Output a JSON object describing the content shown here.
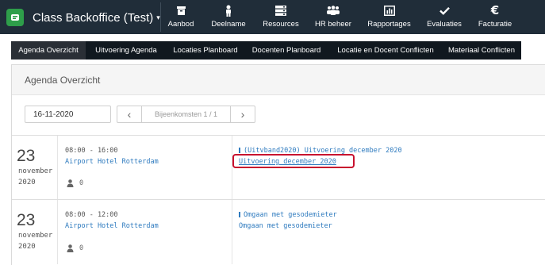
{
  "app": {
    "title": "Class Backoffice (Test)",
    "caret": "▾"
  },
  "topnav": [
    {
      "label": "Aanbod",
      "icon": "box-icon"
    },
    {
      "label": "Deelname",
      "icon": "person-icon"
    },
    {
      "label": "Resources",
      "icon": "server-icon"
    },
    {
      "label": "HR beheer",
      "icon": "users-icon"
    },
    {
      "label": "Rapportages",
      "icon": "bar-chart-icon"
    },
    {
      "label": "Evaluaties",
      "icon": "checkmark-icon"
    },
    {
      "label": "Facturatie",
      "icon": "euro-icon"
    }
  ],
  "subnav": [
    {
      "label": "Agenda Overzicht",
      "active": true
    },
    {
      "label": "Uitvoering Agenda"
    },
    {
      "label": "Locaties Planboard"
    },
    {
      "label": "Docenten Planboard"
    },
    {
      "label": "Locatie en Docent Conflicten"
    },
    {
      "label": "Materiaal Conflicten"
    }
  ],
  "panel": {
    "title": "Agenda Overzicht"
  },
  "toolbar": {
    "date": "16-11-2020",
    "prev": "‹",
    "pager_text": "Bijeenkomsten 1 / 1",
    "next": "›"
  },
  "entries": [
    {
      "day": "23",
      "month": "november",
      "year": "2020",
      "time": "08:00 - 16:00",
      "location": "Airport Hotel Rotterdam",
      "participants": "0",
      "course": "(Uitvband2020) Uitvoering december 2020",
      "execution": "Uitvoering december 2020"
    },
    {
      "day": "23",
      "month": "november",
      "year": "2020",
      "time": "08:00 - 12:00",
      "location": "Airport Hotel Rotterdam",
      "participants": "0",
      "course": "Omgaan met gesodemieter",
      "execution": "Omgaan met gesodemieter"
    }
  ],
  "colors": {
    "topbar": "#202d39",
    "accent_link": "#2f7bbf",
    "highlight": "#c8102e",
    "brand": "#2e9e4a"
  }
}
